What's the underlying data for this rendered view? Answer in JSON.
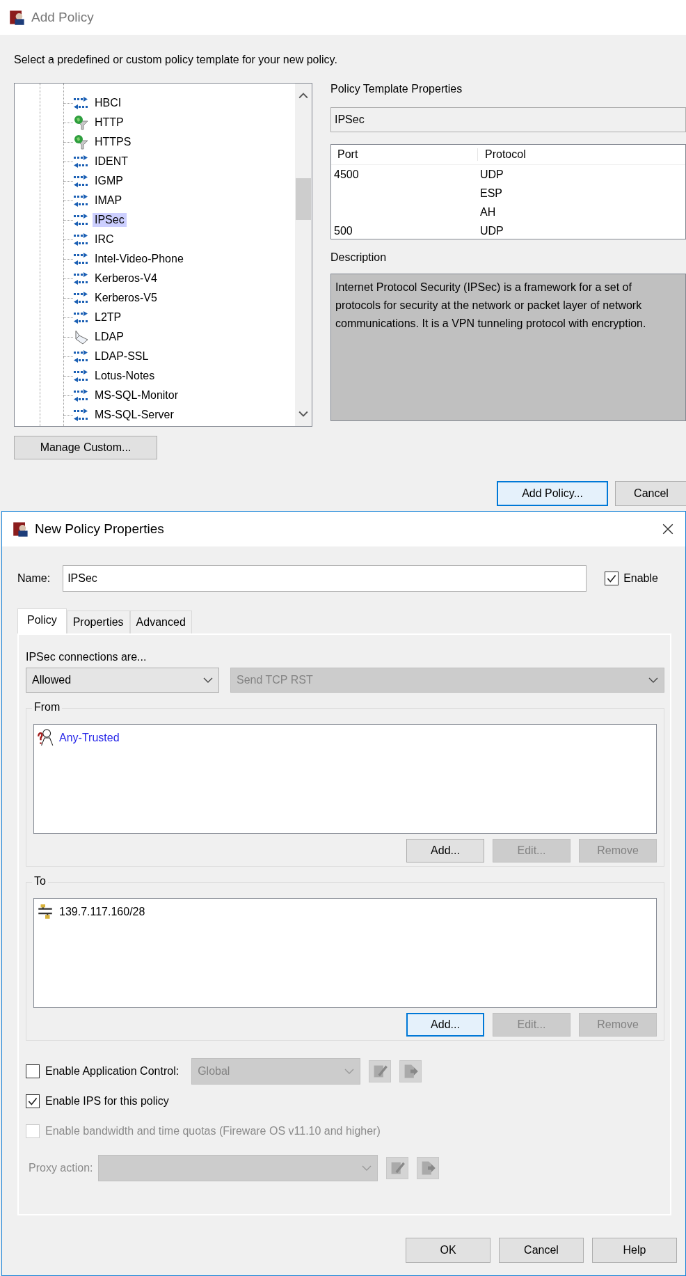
{
  "add_policy_window": {
    "title": "Add Policy",
    "instruction": "Select a predefined or custom policy template for your new policy.",
    "template_tree": {
      "items": [
        {
          "label": "HBCI",
          "kind": "arrows",
          "selected": false
        },
        {
          "label": "HTTP",
          "kind": "globe",
          "selected": false
        },
        {
          "label": "HTTPS",
          "kind": "globe",
          "selected": false
        },
        {
          "label": "IDENT",
          "kind": "arrows",
          "selected": false
        },
        {
          "label": "IGMP",
          "kind": "arrows",
          "selected": false
        },
        {
          "label": "IMAP",
          "kind": "arrows",
          "selected": false
        },
        {
          "label": "IPSec",
          "kind": "arrows",
          "selected": true
        },
        {
          "label": "IRC",
          "kind": "arrows",
          "selected": false
        },
        {
          "label": "Intel-Video-Phone",
          "kind": "arrows",
          "selected": false
        },
        {
          "label": "Kerberos-V4",
          "kind": "arrows",
          "selected": false
        },
        {
          "label": "Kerberos-V5",
          "kind": "arrows",
          "selected": false
        },
        {
          "label": "L2TP",
          "kind": "arrows",
          "selected": false
        },
        {
          "label": "LDAP",
          "kind": "directory",
          "selected": false
        },
        {
          "label": "LDAP-SSL",
          "kind": "arrows",
          "selected": false
        },
        {
          "label": "Lotus-Notes",
          "kind": "arrows",
          "selected": false
        },
        {
          "label": "MS-SQL-Monitor",
          "kind": "arrows",
          "selected": false
        },
        {
          "label": "MS-SQL-Server",
          "kind": "arrows",
          "selected": false
        }
      ]
    },
    "manage_button": "Manage Custom...",
    "properties": {
      "heading": "Policy Template Properties",
      "template_name": "IPSec",
      "ports_table": {
        "columns": [
          "Port",
          "Protocol"
        ],
        "rows": [
          [
            "4500",
            "UDP"
          ],
          [
            "",
            "ESP"
          ],
          [
            "",
            "AH"
          ],
          [
            "500",
            "UDP"
          ]
        ]
      },
      "description_label": "Description",
      "description": "Internet Protocol Security (IPSec) is a framework for a set of protocols for security at the network or packet layer of network communications. It is a VPN tunneling protocol with encryption."
    },
    "buttons": [
      {
        "label": "Add Policy...",
        "focused": true
      },
      {
        "label": "Cancel",
        "focused": false
      }
    ]
  },
  "new_policy_window": {
    "title": "New Policy Properties",
    "name_label": "Name:",
    "name_value": "IPSec",
    "enable": {
      "label": "Enable",
      "checked": true
    },
    "tabs": [
      {
        "label": "Policy",
        "selected": true
      },
      {
        "label": "Properties",
        "selected": false
      },
      {
        "label": "Advanced",
        "selected": false
      }
    ],
    "connections_label": "IPSec connections are...",
    "action_select": {
      "value": "Allowed",
      "disabled": false
    },
    "reject_select": {
      "value": "Send TCP RST",
      "disabled": true
    },
    "groups": [
      {
        "legend": "From",
        "members": [
          {
            "label": "Any-Trusted",
            "kind": "alias"
          }
        ],
        "buttons": [
          {
            "label": "Add...",
            "disabled": false,
            "focused": false
          },
          {
            "label": "Edit...",
            "disabled": true,
            "focused": false
          },
          {
            "label": "Remove",
            "disabled": true,
            "focused": false
          }
        ]
      },
      {
        "legend": "To",
        "members": [
          {
            "label": "139.7.117.160/28",
            "kind": "network"
          }
        ],
        "buttons": [
          {
            "label": "Add...",
            "disabled": false,
            "focused": true
          },
          {
            "label": "Edit...",
            "disabled": true,
            "focused": false
          },
          {
            "label": "Remove",
            "disabled": true,
            "focused": false
          }
        ]
      }
    ],
    "options": [
      {
        "kind": "checkbox-select",
        "label": "Enable Application Control:",
        "checked": false,
        "disabled": false,
        "select": {
          "value": "Global",
          "disabled": true
        }
      },
      {
        "kind": "checkbox",
        "label": "Enable IPS for this policy",
        "checked": true,
        "disabled": false
      },
      {
        "kind": "checkbox",
        "label": "Enable bandwidth and time quotas (Fireware OS v11.10 and higher)",
        "checked": false,
        "disabled": true
      },
      {
        "kind": "label-select",
        "label": "Proxy action:",
        "disabled": true
      }
    ],
    "buttons": [
      "OK",
      "Cancel",
      "Help"
    ]
  }
}
